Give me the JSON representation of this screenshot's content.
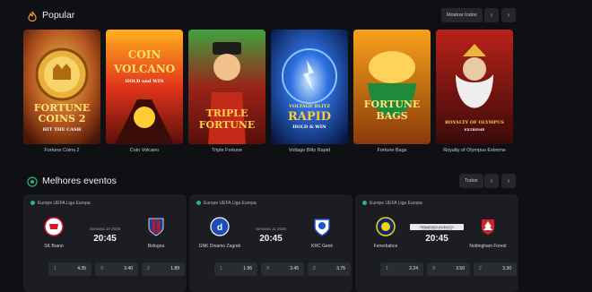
{
  "popular": {
    "title": "Popular",
    "show_all_label": "Mostrar todos",
    "prev_icon": "chevron-left-icon",
    "next_icon": "chevron-right-icon",
    "games": [
      {
        "name": "Fortune Coins 2",
        "art": [
          "FORTUNE",
          "COINS 2",
          "HIT THE CASH"
        ]
      },
      {
        "name": "Coin Volcano",
        "art": [
          "COIN",
          "VOLCANO",
          "HOLD and WIN"
        ]
      },
      {
        "name": "Triple Fortune",
        "art": [
          "TRIPLE",
          "FORTUNE"
        ]
      },
      {
        "name": "Voltage Blitz Rapid",
        "art": [
          "VOLTAGE BLITZ",
          "RAPID",
          "HOLD & WIN"
        ]
      },
      {
        "name": "Fortune Bags",
        "art": [
          "FORTUNE",
          "BAGS"
        ]
      },
      {
        "name": "Royalty of Olympus Extreme",
        "art": [
          "ROYALTY OF OLYMPUS",
          "EXTREME"
        ]
      }
    ]
  },
  "events": {
    "title": "Melhores eventos",
    "all_label": "Todos",
    "prev_icon": "chevron-left-icon",
    "next_icon": "chevron-right-icon",
    "cards": [
      {
        "league": "Europe UEFA Liga Europa",
        "date": "Semana 10 2026",
        "time": "20:45",
        "home": {
          "name": "SK Brann",
          "color": "#d3192b"
        },
        "away": {
          "name": "Bologna",
          "color": "#1f3f8f"
        },
        "odds": [
          {
            "k": "1",
            "v": "4.35"
          },
          {
            "k": "X",
            "v": "3.40"
          },
          {
            "k": "2",
            "v": "1.89"
          }
        ]
      },
      {
        "league": "Europe UEFA Liga Europa",
        "date": "Semana 11 2026",
        "time": "20:45",
        "home": {
          "name": "GNK Dinamo Zagreb",
          "color": "#1e4db3"
        },
        "away": {
          "name": "KRC Genk",
          "color": "#1a56c4"
        },
        "odds": [
          {
            "k": "1",
            "v": "1.96"
          },
          {
            "k": "X",
            "v": "3.45"
          },
          {
            "k": "2",
            "v": "3.75"
          }
        ]
      },
      {
        "league": "Europe UEFA Liga Europa",
        "promo": "PRIMEIRO EVENTO",
        "date": "Semana 12 2026",
        "time": "20:45",
        "home": {
          "name": "Fenerbahce",
          "color": "#f6d30b"
        },
        "away": {
          "name": "Nottingham Forest",
          "color": "#d1212a"
        },
        "odds": [
          {
            "k": "1",
            "v": "2.24"
          },
          {
            "k": "X",
            "v": "3.50"
          },
          {
            "k": "2",
            "v": "3.30"
          }
        ]
      }
    ]
  }
}
